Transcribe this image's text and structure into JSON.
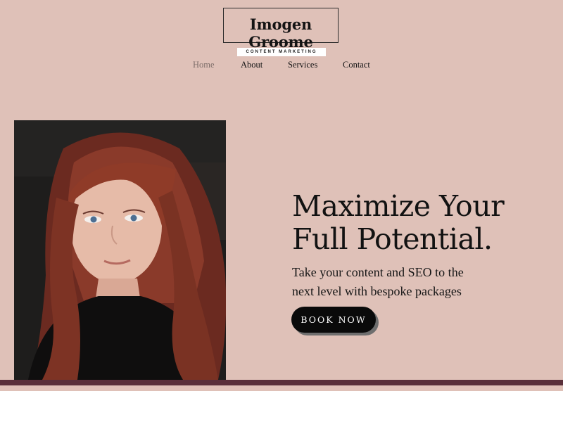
{
  "logo": {
    "name": "Imogen Groome",
    "tagline": "CONTENT MARKETING"
  },
  "nav": {
    "items": [
      {
        "label": "Home",
        "active": true
      },
      {
        "label": "About"
      },
      {
        "label": "Services"
      },
      {
        "label": "Contact"
      }
    ]
  },
  "hero": {
    "headline_line1": "Maximize Your",
    "headline_line2": "Full Potential.",
    "subtext_line1": "Take your content and SEO to the",
    "subtext_line2": "next level with bespoke packages",
    "cta_label": "BOOK NOW",
    "photo_icon": "portrait-photo-icon"
  },
  "colors": {
    "background": "#dfc1b8",
    "accent_bar": "#5a2f3a",
    "button": "#0a0a0a",
    "nav_active": "#7e6e6a"
  }
}
